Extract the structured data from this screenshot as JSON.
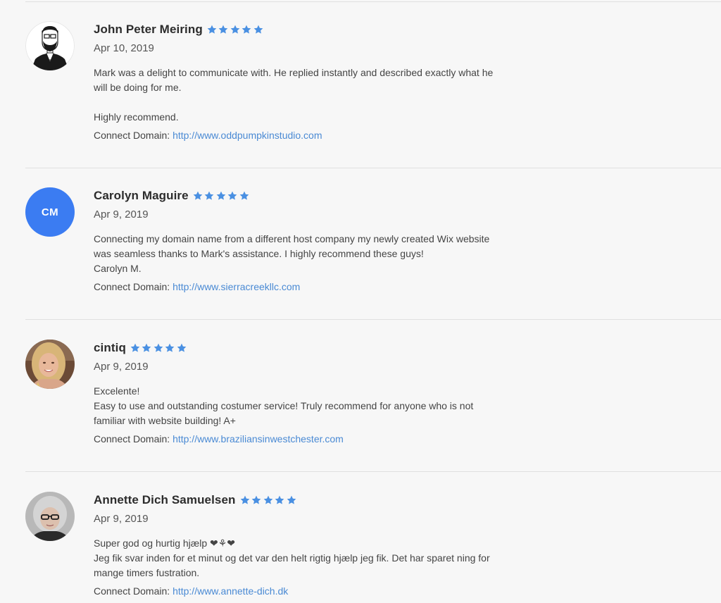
{
  "reviews": [
    {
      "name": "John Peter Meiring",
      "rating": 5,
      "date": "Apr 10, 2019",
      "lines": [
        "Mark was a delight to communicate with. He replied instantly and described exactly what he",
        "will be doing for me.",
        "",
        "Highly recommend."
      ],
      "domain_label": "Connect Domain:",
      "domain_url": "http://www.oddpumpkinstudio.com",
      "avatar": "illustrated-man-avatar"
    },
    {
      "name": "Carolyn Maguire",
      "rating": 5,
      "date": "Apr 9, 2019",
      "lines": [
        "Connecting my domain name from a different host company my newly created Wix website",
        "was seamless thanks to Mark's assistance. I highly recommend these guys!",
        "Carolyn M."
      ],
      "domain_label": "Connect Domain:",
      "domain_url": "http://www.sierracreekllc.com",
      "avatar_initials": "CM",
      "avatar_color": "#3b7cf2"
    },
    {
      "name": "cintiq",
      "rating": 5,
      "date": "Apr 9, 2019",
      "lines": [
        "Excelente!",
        "Easy to use and outstanding costumer service! Truly recommend for anyone who is not",
        "familiar with website building! A+"
      ],
      "domain_label": "Connect Domain:",
      "domain_url": "http://www.braziliansinwestchester.com",
      "avatar": "photo-avatar-blonde-woman"
    },
    {
      "name": "Annette Dich Samuelsen",
      "rating": 5,
      "date": "Apr 9, 2019",
      "lines": [
        "Super god og hurtig hjælp ❤⚘❤",
        "Jeg fik svar inden for et minut og det var den helt rigtig hjælp jeg fik. Det har sparet ning for",
        "mange timers fustration."
      ],
      "domain_label": "Connect Domain:",
      "domain_url": "http://www.annette-dich.dk",
      "avatar": "photo-avatar-gray-haired-woman"
    }
  ],
  "colors": {
    "star": "#4a90e2",
    "link": "#4a8ad4",
    "background": "#f7f7f7",
    "divider": "#e0e0e0"
  }
}
